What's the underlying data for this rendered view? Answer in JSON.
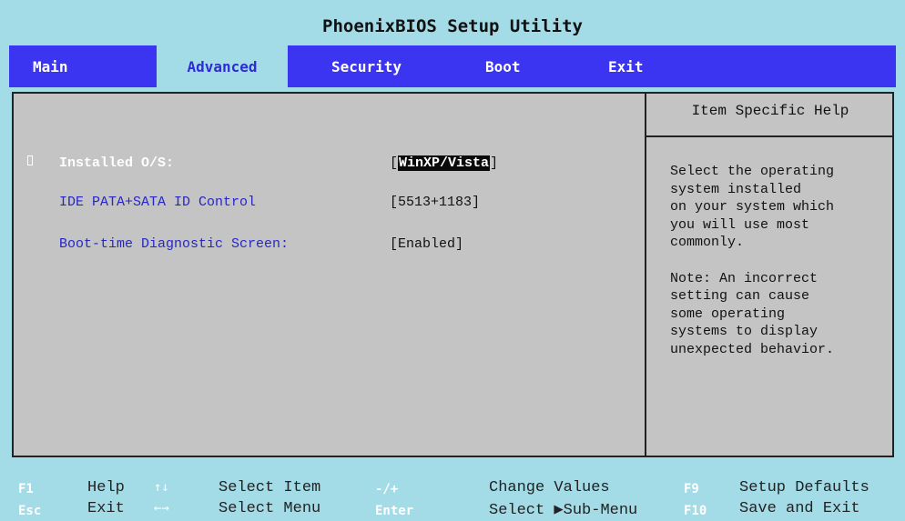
{
  "title": "PhoenixBIOS Setup Utility",
  "menu": {
    "tabs": [
      {
        "label": "Main"
      },
      {
        "label": "Advanced"
      },
      {
        "label": "Security"
      },
      {
        "label": "Boot"
      },
      {
        "label": "Exit"
      }
    ],
    "active": "Advanced"
  },
  "settings": [
    {
      "label": "Installed O/S:",
      "value": "WinXP/Vista"
    },
    {
      "label": "IDE PATA+SATA ID Control",
      "value": "[5513+1183]"
    },
    {
      "label": "Boot-time Diagnostic Screen:",
      "value": "[Enabled]"
    }
  ],
  "bracket_open": "[",
  "bracket_close": "]",
  "help": {
    "title": "Item Specific Help",
    "text": "Select the operating\nsystem installed\non your system which\nyou will use most\ncommonly.\n\nNote: An incorrect\nsetting can cause\nsome operating\nsystems to display\nunexpected behavior."
  },
  "footer": {
    "keys": [
      {
        "key": "F1",
        "desc": "Help"
      },
      {
        "key": "↑↓",
        "desc": "Select Item"
      },
      {
        "key": "-/+",
        "desc": "Change Values"
      },
      {
        "key": "F9",
        "desc": "Setup Defaults"
      },
      {
        "key": "Esc",
        "desc": "Exit"
      },
      {
        "key": "←→",
        "desc": "Select Menu"
      },
      {
        "key": "Enter",
        "desc": "Select ▶Sub-Menu"
      },
      {
        "key": "F10",
        "desc": "Save and Exit"
      }
    ]
  },
  "colors": {
    "menubar": "#3b35f1",
    "background": "#a3dbe7",
    "panel": "#c4c4c4",
    "label_text": "#2626c8"
  }
}
